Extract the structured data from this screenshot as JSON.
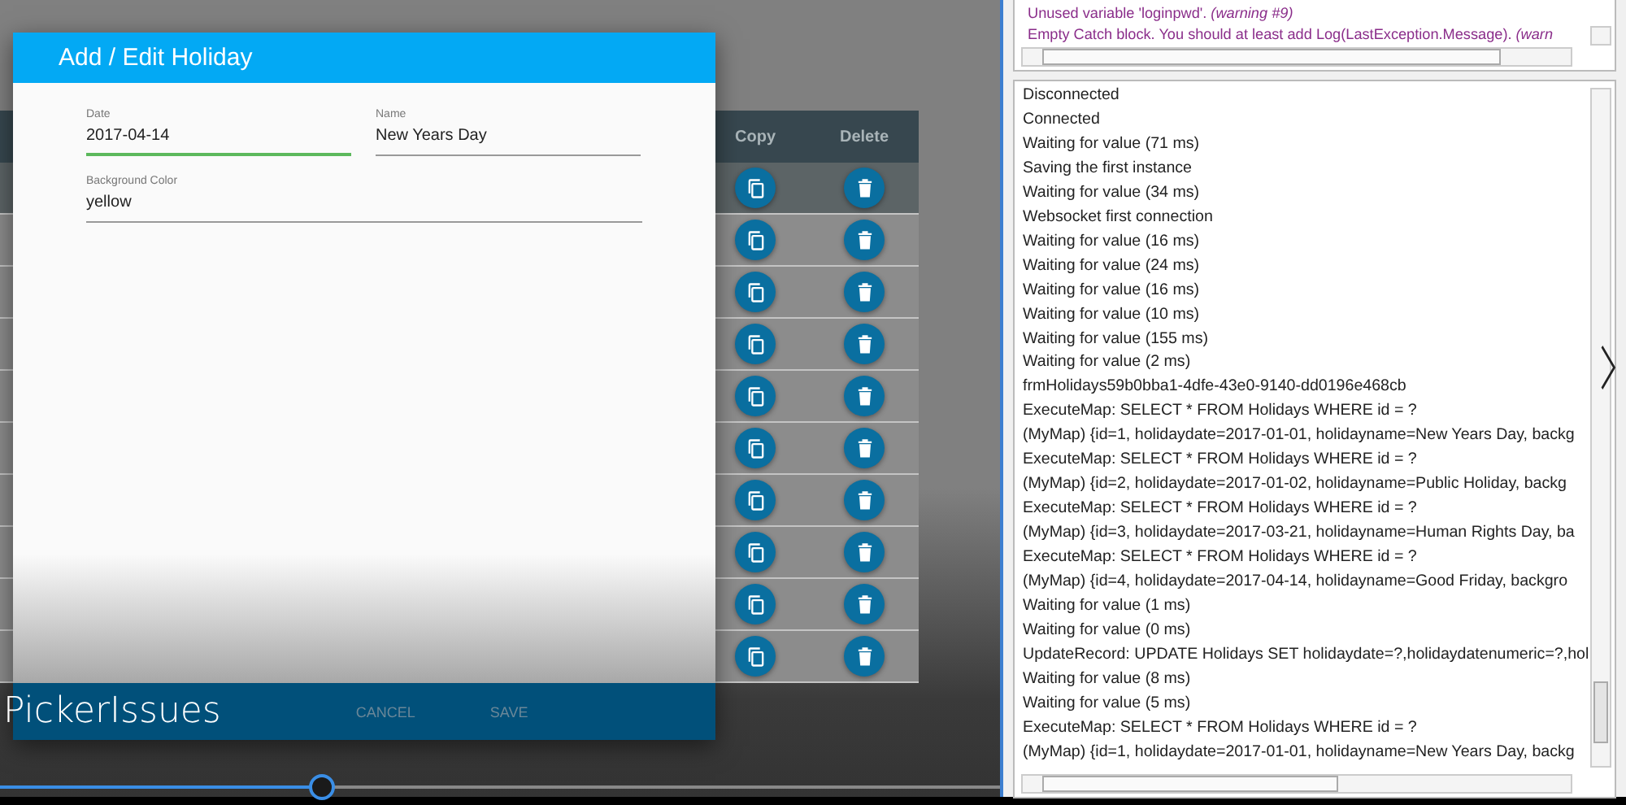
{
  "dialog": {
    "title": "Add / Edit Holiday",
    "fields": [
      {
        "label": "Date",
        "value": "2017-04-14",
        "focused": true,
        "wide": false
      },
      {
        "label": "Name",
        "value": "New Years Day",
        "focused": false,
        "wide": false
      },
      {
        "label": "Background Color",
        "value": "yellow",
        "focused": false,
        "wide": true
      }
    ],
    "app_title": "PickerIssues",
    "buttons": [
      "CANCEL",
      "SAVE"
    ]
  },
  "table": {
    "columns": [
      "Copy",
      "Delete"
    ],
    "rows": [
      {
        "selected": true
      },
      {
        "selected": false
      },
      {
        "selected": false
      },
      {
        "selected": false
      },
      {
        "selected": false
      },
      {
        "selected": false
      },
      {
        "selected": false
      },
      {
        "selected": false
      },
      {
        "selected": false
      },
      {
        "selected": false
      }
    ]
  },
  "warnings": [
    "Unused variable 'loginpwd'. *(warning #9)*",
    "Empty Catch block. You should at least add Log(LastException.Message). *(warn*"
  ],
  "log": [
    "Disconnected",
    "Connected",
    "Waiting for value (71 ms)",
    "Saving the first instance",
    "Waiting for value (34 ms)",
    "Websocket first connection",
    "Waiting for value (16 ms)",
    "Waiting for value (24 ms)",
    "Waiting for value (16 ms)",
    "Waiting for value (10 ms)",
    "Waiting for value (155 ms)",
    "Waiting for value (2 ms)",
    "frmHolidays59b0bba1-4dfe-43e0-9140-dd0196e468cb",
    "ExecuteMap: SELECT * FROM Holidays WHERE id = ?",
    "(MyMap) {id=1, holidaydate=2017-01-01, holidayname=New Years Day, backg",
    "ExecuteMap: SELECT * FROM Holidays WHERE id = ?",
    "(MyMap) {id=2, holidaydate=2017-01-02, holidayname=Public Holiday, backg",
    "ExecuteMap: SELECT * FROM Holidays WHERE id = ?",
    "(MyMap) {id=3, holidaydate=2017-03-21, holidayname=Human Rights Day, ba",
    "ExecuteMap: SELECT * FROM Holidays WHERE id = ?",
    "(MyMap) {id=4, holidaydate=2017-04-14, holidayname=Good Friday, backgro",
    "Waiting for value (1 ms)",
    "Waiting for value (0 ms)",
    "UpdateRecord: UPDATE Holidays SET holidaydate=?,holidaydatenumeric=?,hol",
    "Waiting for value (8 ms)",
    "Waiting for value (5 ms)",
    "ExecuteMap: SELECT * FROM Holidays WHERE id = ?",
    "(MyMap) {id=1, holidaydate=2017-01-01, holidayname=New Years Day, backg"
  ],
  "video_slider": {
    "level": 0.322
  }
}
